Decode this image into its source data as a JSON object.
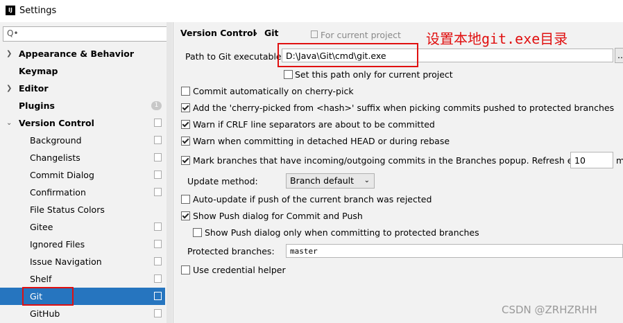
{
  "window": {
    "title": "Settings",
    "app_icon_text": "IJ"
  },
  "sidebar": {
    "search_placeholder": "Q•",
    "items": [
      {
        "label": "Appearance & Behavior"
      },
      {
        "label": "Keymap"
      },
      {
        "label": "Editor"
      },
      {
        "label": "Plugins",
        "badge": "1"
      },
      {
        "label": "Version Control"
      },
      {
        "label": "Background"
      },
      {
        "label": "Changelists"
      },
      {
        "label": "Commit Dialog"
      },
      {
        "label": "Confirmation"
      },
      {
        "label": "File Status Colors"
      },
      {
        "label": "Gitee"
      },
      {
        "label": "Ignored Files"
      },
      {
        "label": "Issue Navigation"
      },
      {
        "label": "Shelf"
      },
      {
        "label": "Git"
      },
      {
        "label": "GitHub"
      }
    ]
  },
  "main": {
    "breadcrumb": {
      "part1": "Version Control",
      "separator": "›",
      "part2": "Git",
      "scope": "For current project"
    },
    "annotation": "设置本地git.exe目录",
    "path": {
      "label": "Path to Git executable:",
      "value": "D:\\Java\\Git\\cmd\\git.exe",
      "browse": "..."
    },
    "set_path_label": "Set this path only for current project",
    "options": [
      {
        "label": "Commit automatically on cherry-pick",
        "checked": false
      },
      {
        "label": "Add the 'cherry-picked from <hash>' suffix when picking commits pushed to protected branches",
        "checked": true
      },
      {
        "label": "Warn if CRLF line separators are about to be committed",
        "checked": true
      },
      {
        "label": "Warn when committing in detached HEAD or during rebase",
        "checked": true
      },
      {
        "label": "Mark branches that have incoming/outgoing commits in the Branches popup.  Refresh every",
        "checked": true
      }
    ],
    "refresh_value": "10",
    "refresh_unit": "m",
    "update_method": {
      "label": "Update method:",
      "value": "Branch default"
    },
    "auto_update_label": "Auto-update if push of the current branch was rejected",
    "show_push_label": "Show Push dialog for Commit and Push",
    "show_push_protected_label": "Show Push dialog only when committing to protected branches",
    "protected": {
      "label": "Protected branches:",
      "value": "master"
    },
    "credential_label": "Use credential helper"
  },
  "watermark": "CSDN @ZRHZRHH",
  "colors": {
    "selection": "#2675bf",
    "annotation_red": "#e01010"
  }
}
